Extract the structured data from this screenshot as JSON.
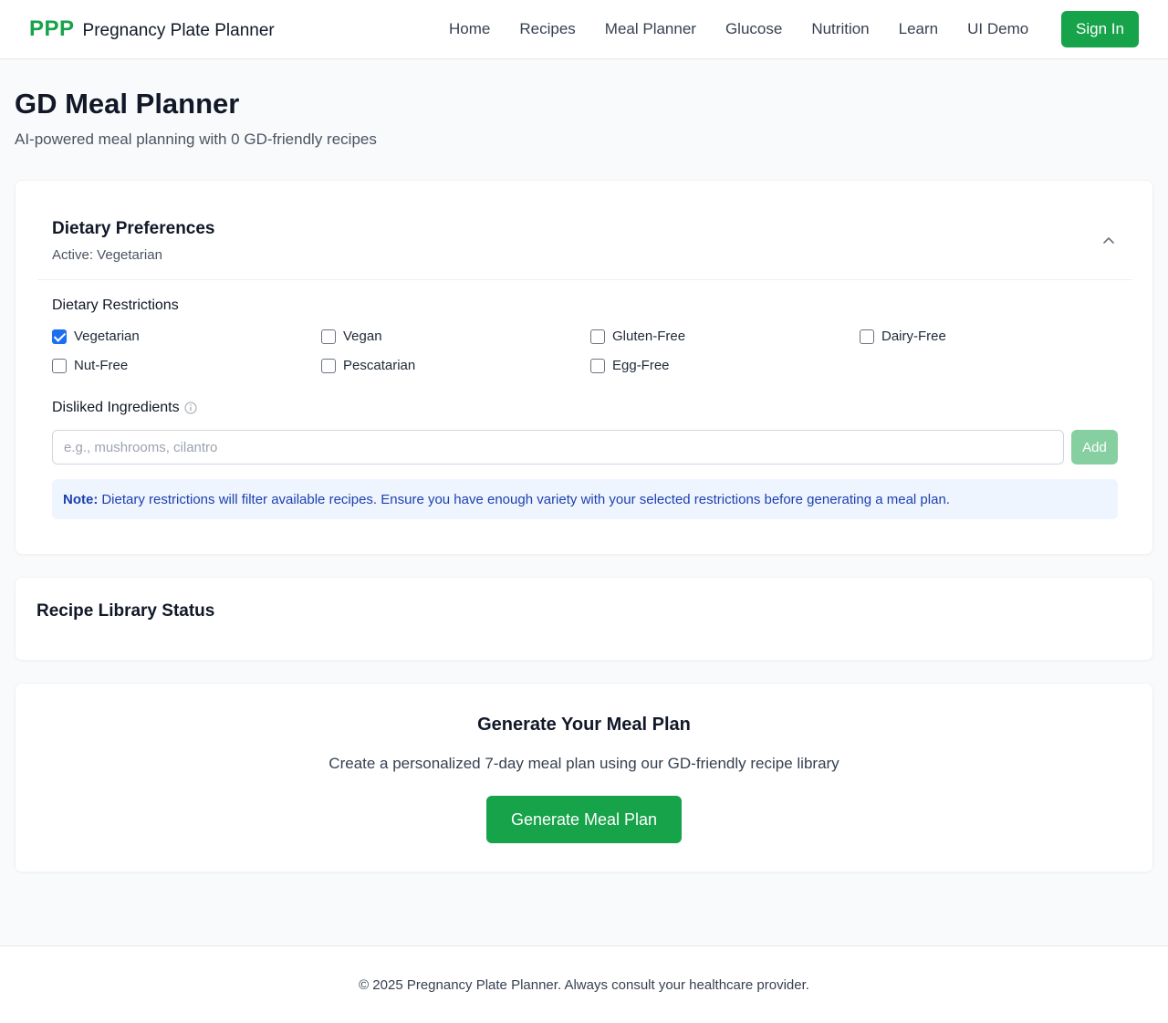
{
  "header": {
    "logo": "PPP",
    "app_name": "Pregnancy Plate Planner",
    "nav": [
      "Home",
      "Recipes",
      "Meal Planner",
      "Glucose",
      "Nutrition",
      "Learn",
      "UI Demo"
    ],
    "sign_in": "Sign In"
  },
  "page": {
    "title": "GD Meal Planner",
    "subtitle": "AI-powered meal planning with 0 GD-friendly recipes"
  },
  "preferences": {
    "title": "Dietary Preferences",
    "active": "Active: Vegetarian",
    "expanded_icon": "chevron-up-icon",
    "restrictions_label": "Dietary Restrictions",
    "restrictions": [
      {
        "label": "Vegetarian",
        "checked": true
      },
      {
        "label": "Vegan",
        "checked": false
      },
      {
        "label": "Gluten-Free",
        "checked": false
      },
      {
        "label": "Dairy-Free",
        "checked": false
      },
      {
        "label": "Nut-Free",
        "checked": false
      },
      {
        "label": "Pescatarian",
        "checked": false
      },
      {
        "label": "Egg-Free",
        "checked": false
      }
    ],
    "disliked_label": "Disliked Ingredients",
    "disliked_placeholder": "e.g., mushrooms, cilantro",
    "disliked_value": "",
    "add_label": "Add",
    "note_bold": "Note:",
    "note_text": "Dietary restrictions will filter available recipes. Ensure you have enough variety with your selected restrictions before generating a meal plan."
  },
  "library_status": {
    "title": "Recipe Library Status"
  },
  "generate": {
    "title": "Generate Your Meal Plan",
    "description": "Create a personalized 7-day meal plan using our GD-friendly recipe library",
    "button": "Generate Meal Plan"
  },
  "footer": {
    "text": "© 2025 Pregnancy Plate Planner. Always consult your healthcare provider."
  },
  "colors": {
    "brand": "#16a34a",
    "checkbox_checked": "#1d6ff2",
    "note_bg": "#eef5ff",
    "note_text": "#1e40af"
  }
}
